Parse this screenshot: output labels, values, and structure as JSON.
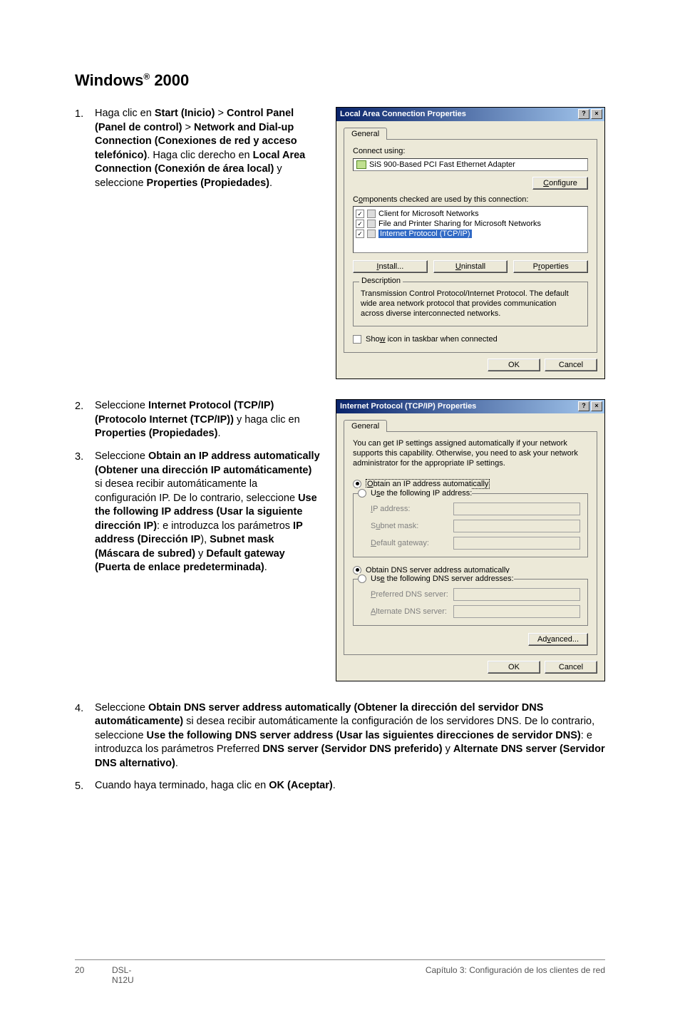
{
  "heading_pre": "Windows",
  "heading_sup": "®",
  "heading_post": " 2000",
  "step1_num": "1.",
  "step1_a": "Haga clic en ",
  "step1_b": "Start (Inicio)",
  "step1_c": " > ",
  "step1_d": "Control Panel (Panel de control)",
  "step1_e": " > ",
  "step1_f": "Network and Dial-up Connection (Conexiones de red y acceso telefónico)",
  "step1_g": ". Haga clic derecho en ",
  "step1_h": "Local Area Connection (Conexión de área local)",
  "step1_i": " y seleccione ",
  "step1_j": "Properties (Propiedades)",
  "step1_k": ".",
  "step2_num": "2.",
  "step2_a": "Seleccione ",
  "step2_b": "Internet Protocol (TCP/IP) (Protocolo Internet (TCP/IP))",
  "step2_c": " y haga clic en ",
  "step2_d": "Properties (Propiedades)",
  "step2_e": ".",
  "step3_num": "3.",
  "step3_a": "Seleccione ",
  "step3_b": "Obtain an IP address automatically (Obtener una dirección IP automáticamente)",
  "step3_c": " si desea recibir automáticamente la configuración IP. De lo contrario, seleccione ",
  "step3_d": "Use the following IP address (Usar la siguiente dirección IP)",
  "step3_e": ": e introduzca los parámetros ",
  "step3_f": "IP address (Dirección IP",
  "step3_g": "), ",
  "step3_h": "Subnet mask (Máscara de subred)",
  "step3_i": " y ",
  "step3_j": "Default gateway (Puerta de enlace predeterminada)",
  "step3_k": ".",
  "step4_num": "4.",
  "step4_a": "Seleccione ",
  "step4_b": "Obtain DNS server address automatically (Obtener la dirección del servidor DNS automáticamente)",
  "step4_c": " si desea recibir automáticamente la configuración de los servidores DNS. De lo contrario, seleccione ",
  "step4_d": "Use the following DNS server address (Usar las siguientes direcciones de servidor DNS)",
  "step4_e": ": e introduzca los parámetros Preferred ",
  "step4_f": "DNS server (Servidor DNS preferido)",
  "step4_g": " y ",
  "step4_h": "Alternate DNS server (Servidor DNS alternativo)",
  "step4_i": ".",
  "step5_num": "5.",
  "step5_a": "Cuando haya terminado, haga clic en ",
  "step5_b": "OK (Aceptar)",
  "step5_c": ".",
  "dlg1": {
    "title": "Local Area Connection Properties",
    "help": "?",
    "close": "×",
    "tab_general": "General",
    "connect_using": "Connect using:",
    "adapter": "SiS 900-Based PCI Fast Ethernet Adapter",
    "configure_u": "C",
    "configure_rest": "onfigure",
    "components_pre": "C",
    "components_u": "o",
    "components_rest": "mponents checked are used by this connection:",
    "item1": "Client for Microsoft Networks",
    "item2": "File and Printer Sharing for Microsoft Networks",
    "item3": "Internet Protocol (TCP/IP)",
    "check": "✓",
    "install_u": "I",
    "install_rest": "nstall...",
    "uninstall_u": "U",
    "uninstall_rest": "ninstall",
    "properties_pre": "P",
    "properties_u": "r",
    "properties_rest": "operties",
    "desc_legend": "Description",
    "desc_text": "Transmission Control Protocol/Internet Protocol. The default wide area network protocol that provides communication across diverse interconnected networks.",
    "show_pre": "Sho",
    "show_u": "w",
    "show_rest": " icon in taskbar when connected",
    "ok": "OK",
    "cancel": "Cancel"
  },
  "dlg2": {
    "title": "Internet Protocol (TCP/IP) Properties",
    "help": "?",
    "close": "×",
    "tab_general": "General",
    "intro": "You can get IP settings assigned automatically if your network supports this capability. Otherwise, you need to ask your network administrator for the appropriate IP settings.",
    "r1_u": "O",
    "r1_rest": "btain an IP address automatically",
    "r2_pre": "U",
    "r2_u": "s",
    "r2_rest": "e the following IP address:",
    "ip_u": "I",
    "ip_rest": "P address:",
    "sub_pre": "S",
    "sub_u": "u",
    "sub_rest": "bnet mask:",
    "gw_u": "D",
    "gw_rest": "efault gateway:",
    "r3_pre": "O",
    "r3_u": "b",
    "r3_rest": "tain DNS server address automatically",
    "r4_pre": "Us",
    "r4_u": "e",
    "r4_rest": " the following DNS server addresses:",
    "pdns_u": "P",
    "pdns_rest": "referred DNS server:",
    "adns_u": "A",
    "adns_rest": "lternate DNS server:",
    "adv_pre": "Ad",
    "adv_u": "v",
    "adv_rest": "anced...",
    "ok": "OK",
    "cancel": "Cancel"
  },
  "footer": {
    "page": "20",
    "model": "DSL-N12U",
    "chapter": "Capítulo 3: Configuración de los clientes de red"
  }
}
